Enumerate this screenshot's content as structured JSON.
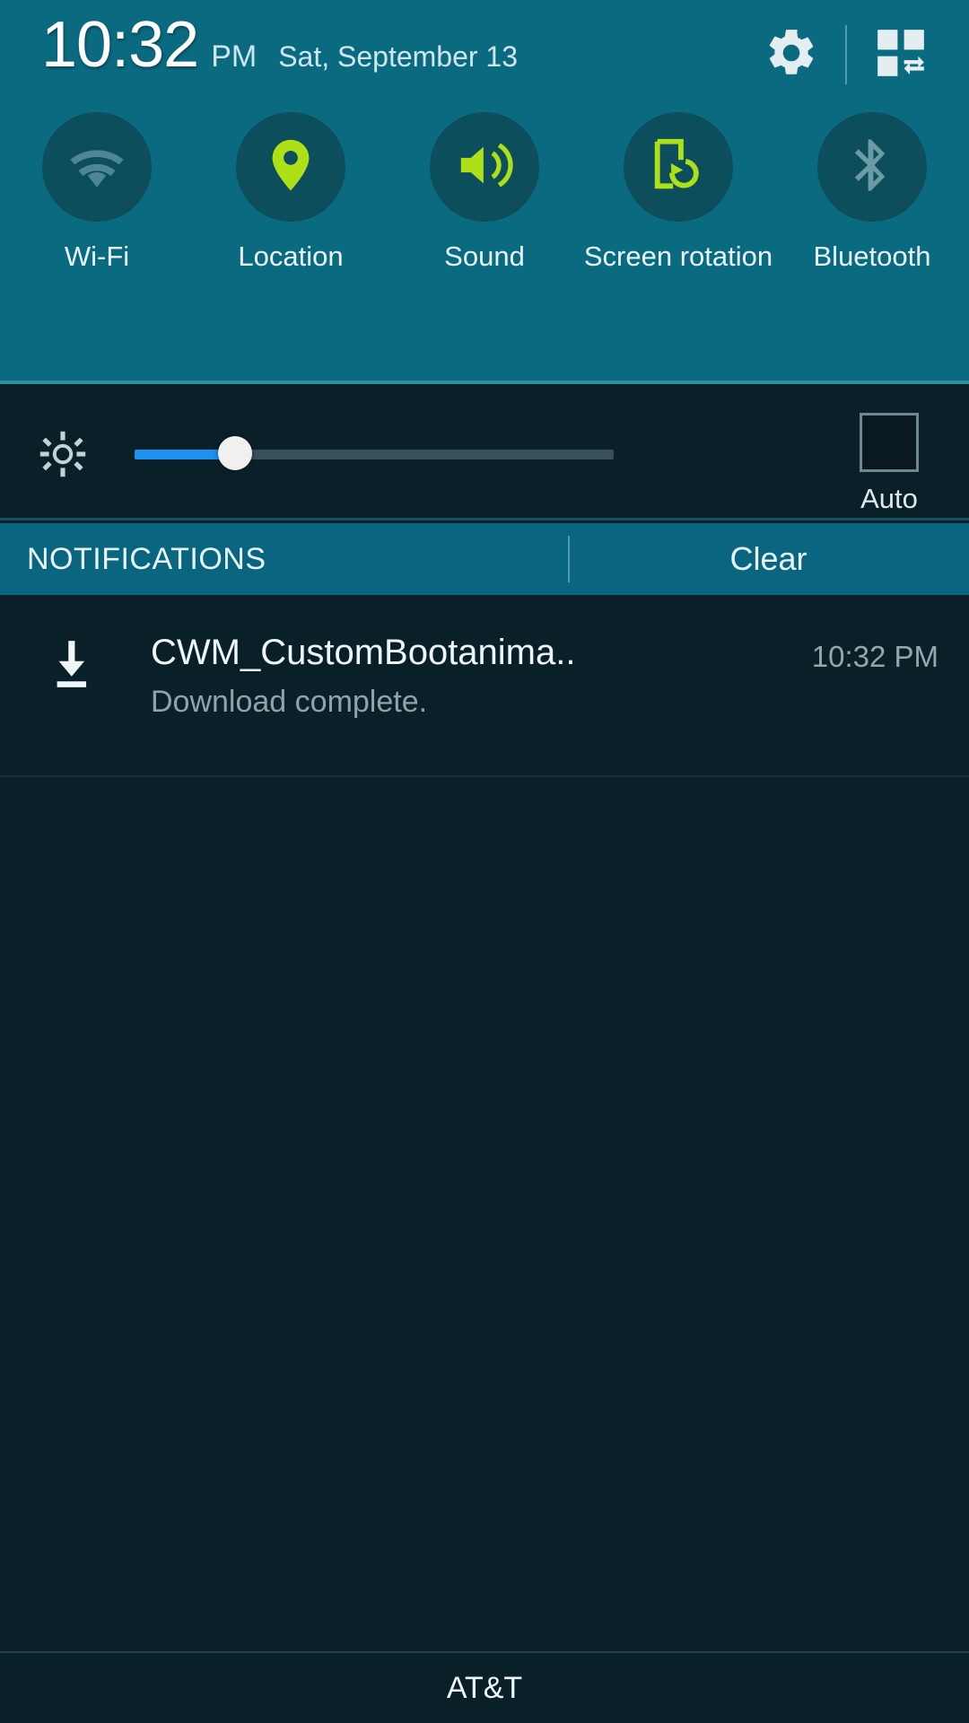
{
  "status_bar": {
    "time": "10:32",
    "ampm": "PM",
    "date": "Sat, September 13",
    "settings_icon": "gear-icon",
    "quick_settings_icon": "quick-settings-grid-icon"
  },
  "quick_toggles": [
    {
      "label": "Wi-Fi",
      "icon": "wifi-icon",
      "state": "off"
    },
    {
      "label": "Location",
      "icon": "location-pin-icon",
      "state": "on"
    },
    {
      "label": "Sound",
      "icon": "sound-speaker-icon",
      "state": "on"
    },
    {
      "label": "Screen\nrotation",
      "icon": "screen-rotation-icon",
      "state": "on"
    },
    {
      "label": "Bluetooth",
      "icon": "bluetooth-icon",
      "state": "off"
    }
  ],
  "brightness": {
    "icon": "brightness-gear-icon",
    "value_percent": 21,
    "auto_label": "Auto",
    "auto_checked": false
  },
  "notifications_header": {
    "title": "NOTIFICATIONS",
    "clear_label": "Clear"
  },
  "notifications": [
    {
      "icon": "download-complete-icon",
      "title": "CWM_CustomBootanima..",
      "time": "10:32 PM",
      "subtitle": "Download complete."
    }
  ],
  "footer": {
    "carrier": "AT&T"
  },
  "colors": {
    "panel_teal": "#0a6a80",
    "toggle_circle": "#0d4e5c",
    "accent_green": "#aee018",
    "inactive_grey": "#5d8a94",
    "background_dark": "#0a2029",
    "slider_blue": "#1e90f0"
  }
}
